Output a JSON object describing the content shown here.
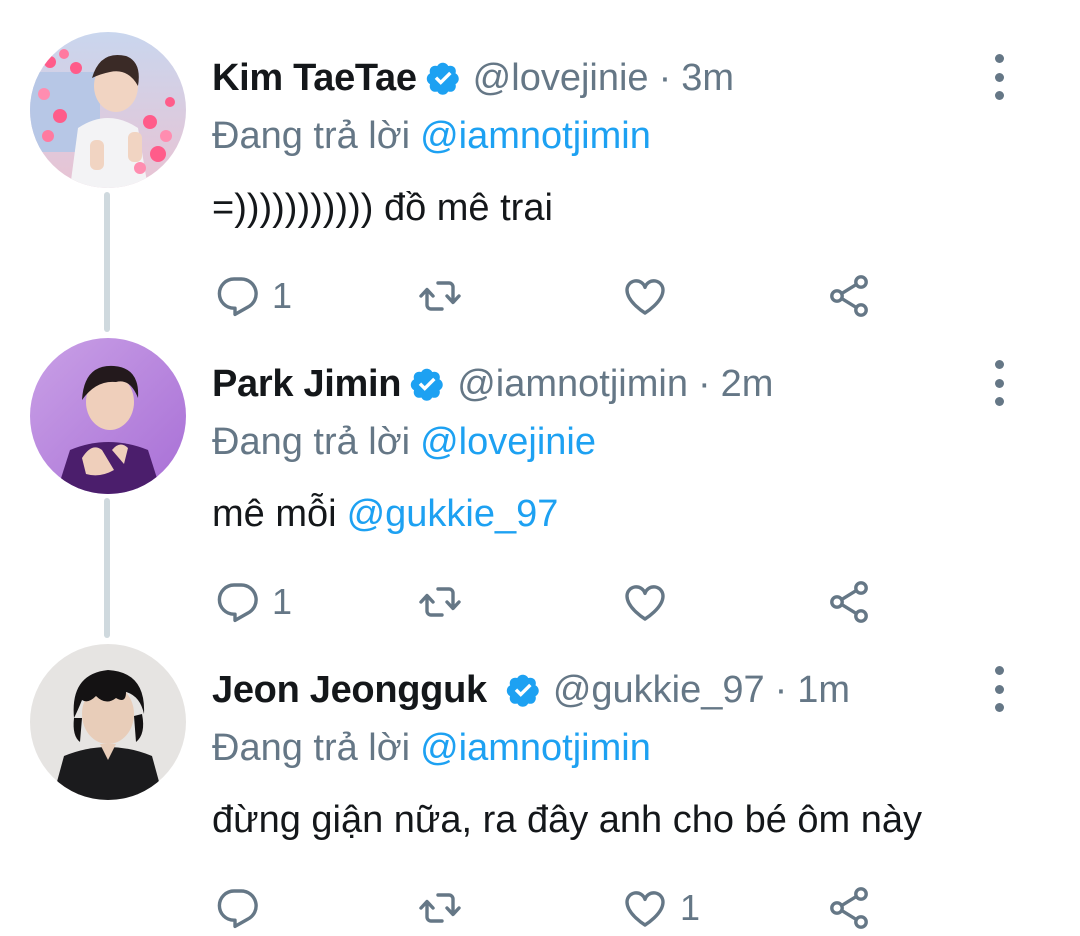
{
  "tweets": [
    {
      "display_name": "Kim TaeTae",
      "handle": "@lovejinie",
      "separator": "·",
      "time": "3m",
      "replying_label": "Đang trả lời",
      "replying_to": "@iamnotjimin",
      "text": "=))))))))))) đồ mê trai",
      "mention": "",
      "reply_count": "1",
      "like_count": ""
    },
    {
      "display_name": "Park Jimin",
      "handle": "@iamnotjimin",
      "separator": "·",
      "time": "2m",
      "replying_label": "Đang trả lời",
      "replying_to": "@lovejinie",
      "text": "mê mỗi",
      "mention": "@gukkie_97",
      "reply_count": "1",
      "like_count": ""
    },
    {
      "display_name": "Jeon Jeongguk",
      "handle": "@gukkie_97",
      "separator": "·",
      "time": "1m",
      "replying_label": "Đang trả lời",
      "replying_to": "@iamnotjimin",
      "text": "đừng giận nữa, ra đây anh cho bé ôm này",
      "mention": "",
      "reply_count": "",
      "like_count": "1"
    }
  ],
  "icons": {
    "verified": "verified-badge-icon",
    "more": "more-vertical-icon",
    "reply": "reply-icon",
    "retweet": "retweet-icon",
    "like": "like-icon",
    "share": "share-icon"
  },
  "colors": {
    "accent": "#1da1f2",
    "secondary_text": "#657786",
    "primary_text": "#14171a",
    "thread_line": "#cfd9de"
  }
}
